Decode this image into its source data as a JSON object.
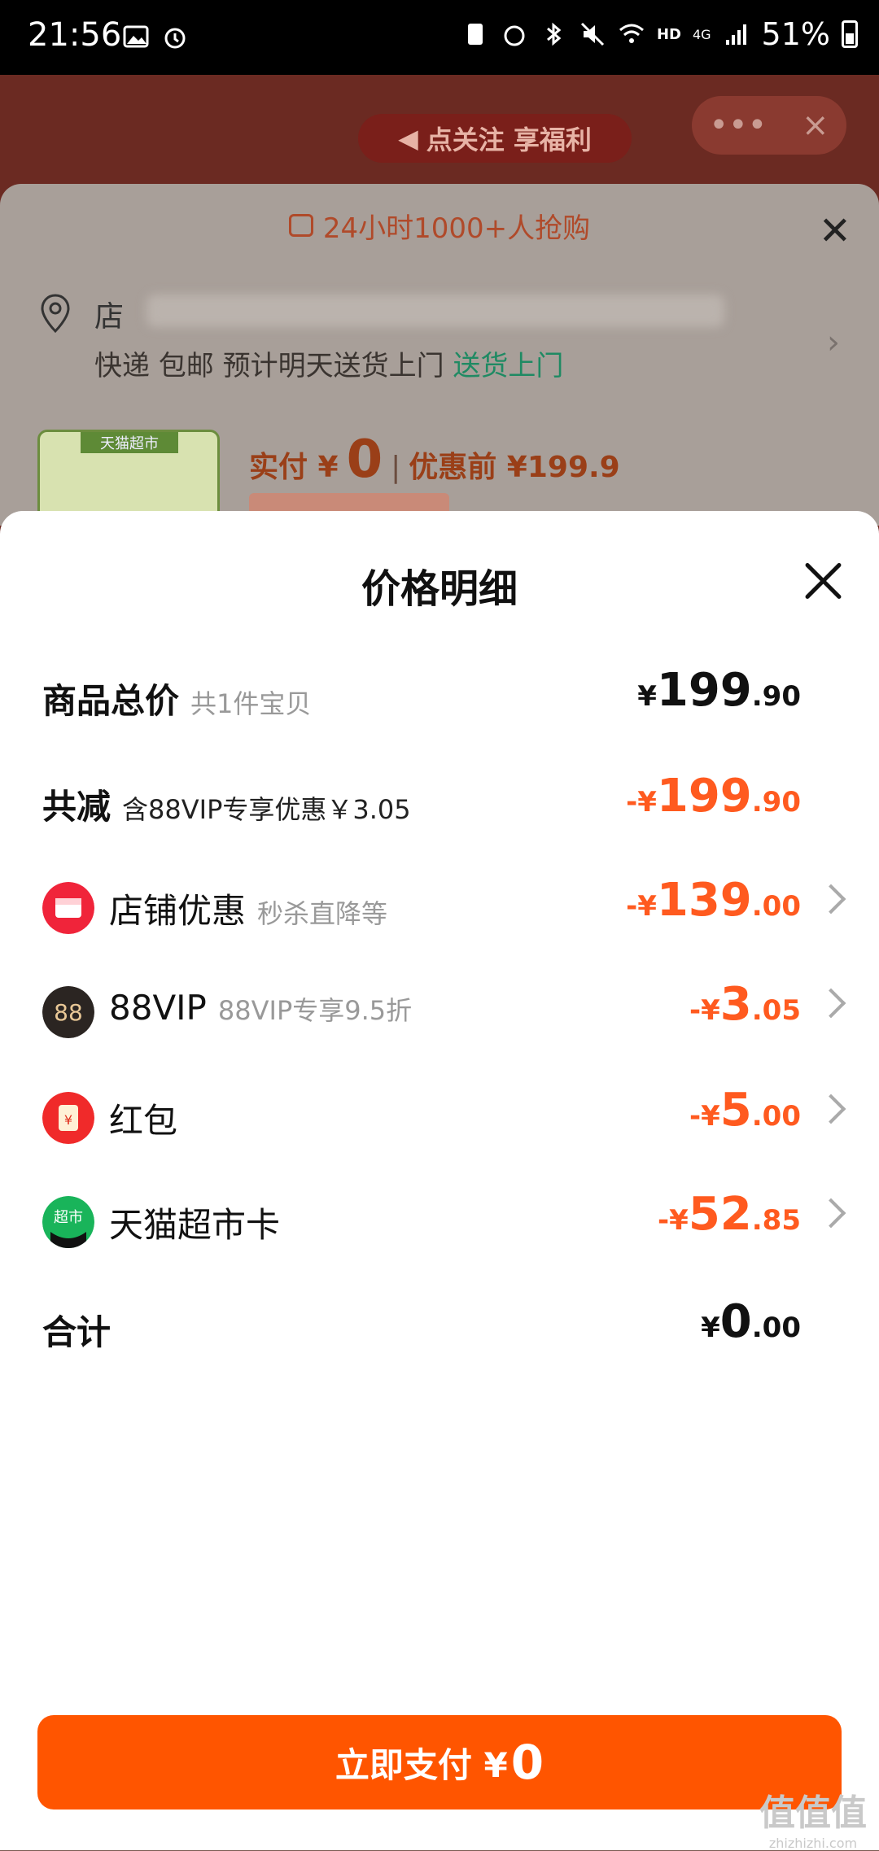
{
  "status_bar": {
    "time": "21:56",
    "net": "HD",
    "signal": "4G",
    "battery": "51%"
  },
  "background": {
    "follow_banner": "点关注 享福利",
    "more_icon": "•••",
    "close_icon": "×",
    "hot_text": "24小时1000+人抢购",
    "address_first_char": "店",
    "delivery_text": "快递 包邮 预计明天送货上门",
    "delivery_link": "送货上门",
    "product_tag": "天猫超市",
    "actual_pay_label": "实付 ¥",
    "actual_pay_value": "0",
    "before_discount": "优惠前 ¥199.9"
  },
  "price_sheet": {
    "title": "价格明细",
    "rows": [
      {
        "label": "商品总价",
        "sub": "共1件宝贝",
        "yen": "¥",
        "int": "199",
        "dec": ".90"
      },
      {
        "label": "共减",
        "sub": "含88VIP专享优惠￥3.05",
        "yen": "-¥",
        "int": "199",
        "dec": ".90"
      },
      {
        "label": "店铺优惠",
        "sub": "秒杀直降等",
        "yen": "-¥",
        "int": "139",
        "dec": ".00"
      },
      {
        "label": "88VIP",
        "sub": "88VIP专享9.5折",
        "yen": "-¥",
        "int": "3",
        "dec": ".05"
      },
      {
        "label": "红包",
        "sub": "",
        "yen": "-¥",
        "int": "5",
        "dec": ".00"
      },
      {
        "label": "天猫超市卡",
        "sub": "",
        "yen": "-¥",
        "int": "52",
        "dec": ".85"
      },
      {
        "label": "合计",
        "sub": "",
        "yen": "¥",
        "int": "0",
        "dec": ".00"
      }
    ],
    "icons": {
      "shop": "店铺优惠",
      "vip": "88",
      "redpacket": "¥",
      "supermarket": "超市"
    },
    "pay_button": {
      "label": "立即支付 ¥",
      "amount": "0"
    }
  },
  "watermark": {
    "big": "值值值",
    "small": "zhizhizhi.com"
  },
  "colors": {
    "accent": "#ff5500",
    "discount_red": "#ff5a1f",
    "green": "#1f8a63"
  }
}
